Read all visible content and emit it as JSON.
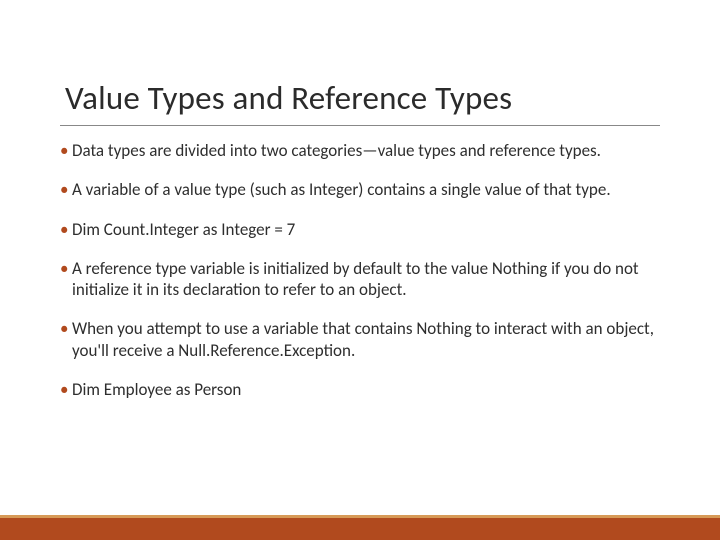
{
  "title": "Value Types and Reference Types",
  "bullets": [
    "Data types are divided into two categories—value types and reference types.",
    "A variable of a value type (such as Integer) contains a single value of that type.",
    "Dim Count.Integer as Integer = 7",
    "A reference type variable is initialized by default to the value Nothing if you do not initialize it in its declaration to refer to an object.",
    "When you attempt to use a variable that contains Nothing to interact with an object, you'll receive a Null.Reference.Exception.",
    "Dim Employee as Person"
  ],
  "colors": {
    "accent": "#b14a1e",
    "stripe": "#d79a57"
  }
}
